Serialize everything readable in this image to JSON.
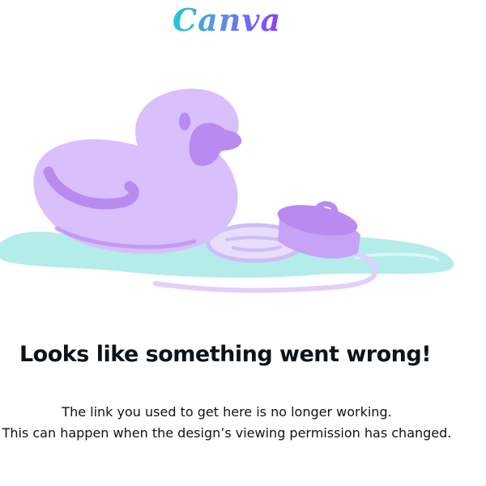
{
  "brand": {
    "logo_text": "Canva"
  },
  "error": {
    "headline": "Looks like something went wrong!",
    "line1": "The link you used to get here is no longer working.",
    "line2": "This can happen when the design’s viewing permission has changed."
  },
  "colors": {
    "duck_body": "#d9bffb",
    "duck_accent": "#b98af0",
    "water": "#b3ece9",
    "text": "#0e1318"
  },
  "icons": {
    "illustration": "rubber-duck-icon"
  }
}
